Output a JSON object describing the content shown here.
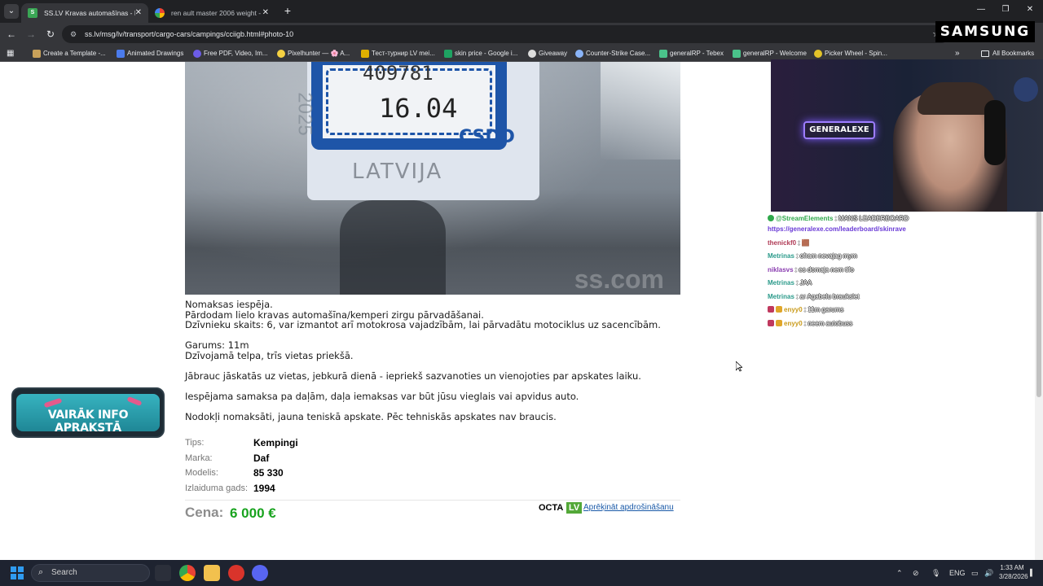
{
  "browser": {
    "tabs": [
      {
        "title": "SS.LV Kravas automašīnas - Kem",
        "active": true
      },
      {
        "title": "ren ault master 2006 weight - G",
        "active": false
      }
    ],
    "url": "ss.lv/msg/lv/transport/cargo-cars/campings/cciigb.html#photo-10",
    "bookmarks": [
      "Create a Template -...",
      "Animated Drawings",
      "Free PDF, Video, Im...",
      "Pixelhunter — 🌸 A...",
      "Тест-турнир LV mei...",
      "skin price - Google i...",
      "Giveaway",
      "Counter-Strike Case...",
      "generalRP - Tebex",
      "generalRP - Welcome",
      "Picker Wheel - Spin..."
    ],
    "all_bookmarks": "All Bookmarks"
  },
  "listing": {
    "photo": {
      "plate_number": "409781",
      "plate_date": "16.04",
      "issuer": "CSDD",
      "country": "LATVIJA",
      "year_fragment": "2025",
      "watermark": "ss.com"
    },
    "description": [
      "Nomaksas iespēja.",
      "Pārdodam lielo kravas automašīna/kemperi zirgu pārvadāšanai.",
      "Dzīvnieku skaits: 6, var izmantot arī motokrosa vajadzībām, lai pārvadātu motociklus uz sacencībām.",
      "",
      "Garums: 11m",
      "Dzīvojamā telpa, trīs vietas priekšā.",
      "",
      "Jābrauc jāskatās uz vietas, jebkurā dienā - iepriekš sazvanoties un vienojoties par apskates laiku.",
      "",
      "Iespējama samaksa pa daļām, daļa iemaksas var būt jūsu vieglais vai apvidus auto.",
      "",
      "Nodokļi nomaksāti, jauna teniskā apskate. Pēc tehniskās apskates nav braucis."
    ],
    "specs": [
      {
        "label": "Tips:",
        "value": "Kempingi"
      },
      {
        "label": "Marka:",
        "value": "Daf"
      },
      {
        "label": "Modelis:",
        "value": "85 330"
      },
      {
        "label": "Izlaiduma gads:",
        "value": "1994"
      }
    ],
    "price_label": "Cena:",
    "price_value": "6 000 €",
    "octa_logo": "OCTA",
    "octa_lv": "LV",
    "octa_link": "Aprēķināt apdrošināšanu",
    "info_button": "VAIRĀK INFO APRAKSTĀ"
  },
  "overlay": {
    "brand": "SAMSUNG",
    "webcam_sign": "GENERALEXE",
    "chat": [
      {
        "user": "@StreamElements",
        "sep": " : ",
        "msg": "MANS LEADERBOARD",
        "color": "#2fa84b"
      },
      {
        "user": "",
        "sep": "",
        "msg": "https://generalexe.com/leaderboard/skinrave",
        "color": "#6a3bd6",
        "link": true
      },
      {
        "user": "thenickf0",
        "sep": " : ",
        "msg": "🟫",
        "color": "#b03a55"
      },
      {
        "user": "Metrinas",
        "sep": " : ",
        "msg": "ofram nevajag mym",
        "color": "#2a9a8a"
      },
      {
        "user": "niklasvs",
        "sep": " : ",
        "msg": "es domaja nem tifo",
        "color": "#8a3db0"
      },
      {
        "user": "Metrinas",
        "sep": " : ",
        "msg": "JAA",
        "color": "#2a9a8a"
      },
      {
        "user": "Metrinas",
        "sep": " : ",
        "msg": "ar Agabelu braukslet",
        "color": "#2a9a8a"
      },
      {
        "user": "enyy0",
        "sep": " : ",
        "msg": "11m garums",
        "color": "#c99a1a",
        "badge": true
      },
      {
        "user": "enyy0",
        "sep": " : ",
        "msg": "neem autobuss",
        "color": "#c99a1a",
        "badge": true
      }
    ]
  },
  "taskbar": {
    "search_placeholder": "Search",
    "lang": "ENG",
    "time": "1:33 AM",
    "date": "3/28/2026"
  }
}
